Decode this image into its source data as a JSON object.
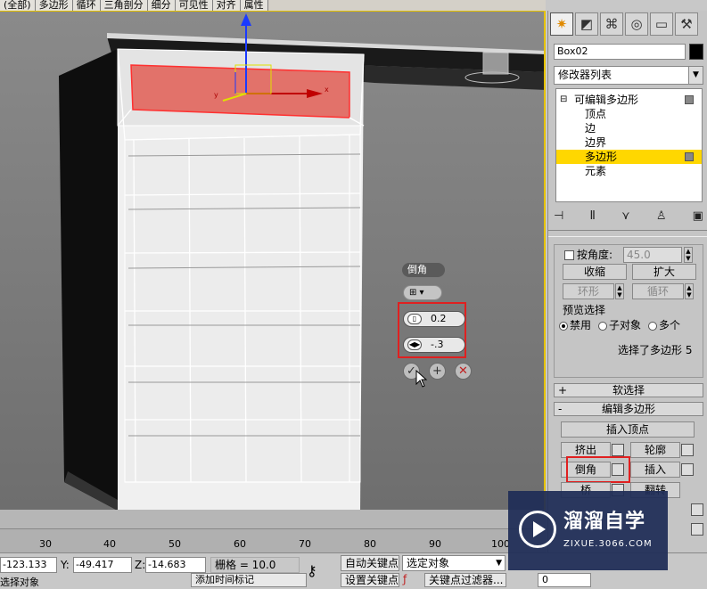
{
  "ribbon": {
    "tabs": [
      "(全部)",
      "多边形",
      "循环",
      "三角剖分",
      "细分",
      "可见性",
      "对齐",
      "属性"
    ]
  },
  "caddy": {
    "title": "倒角",
    "height_value": "0.2",
    "outline_value": "-.3",
    "buttons": {
      "ok": "✓",
      "apply": "+",
      "cancel": "✕"
    }
  },
  "panel": {
    "object_name": "Box02",
    "modifier_list": "修改器列表",
    "stack": [
      "可编辑多边形",
      "顶点",
      "边",
      "边界",
      "多边形",
      "元素"
    ],
    "selection": {
      "by_angle_label": "按角度:",
      "angle_value": "45.0",
      "shrink": "收缩",
      "grow": "扩大",
      "ring": "环形",
      "loop": "循环",
      "preview_title": "预览选择",
      "preview_off": "禁用",
      "preview_subobj": "子对象",
      "preview_multi": "多个",
      "status": "选择了多边形 5"
    },
    "soft_selection": "软选择",
    "edit_polygons": "编辑多边形",
    "insert_vertex": "插入顶点",
    "extrude": "挤出",
    "outline": "轮廓",
    "bevel": "倒角",
    "inset": "插入",
    "bridge": "桥",
    "flip": "翻转"
  },
  "timeline": {
    "ticks": [
      "30",
      "40",
      "50",
      "60",
      "70",
      "80",
      "90",
      "100"
    ]
  },
  "status": {
    "x_value": "-123.133",
    "y_label": "Y:",
    "y_value": "-49.417",
    "z_label": "Z:",
    "z_value": "-14.683",
    "grid_text": "栅格 = 10.0",
    "auto_key": "自动关键点",
    "selected_object": "选定对象",
    "set_key": "设置关键点",
    "key_filters": "关键点过滤器...",
    "left_bottom": "选择对象",
    "add_time_tag": "添加时间标记",
    "frame_value": "0"
  },
  "watermark": {
    "title": "溜溜自学",
    "url": "ZIXUE.3066.COM"
  }
}
